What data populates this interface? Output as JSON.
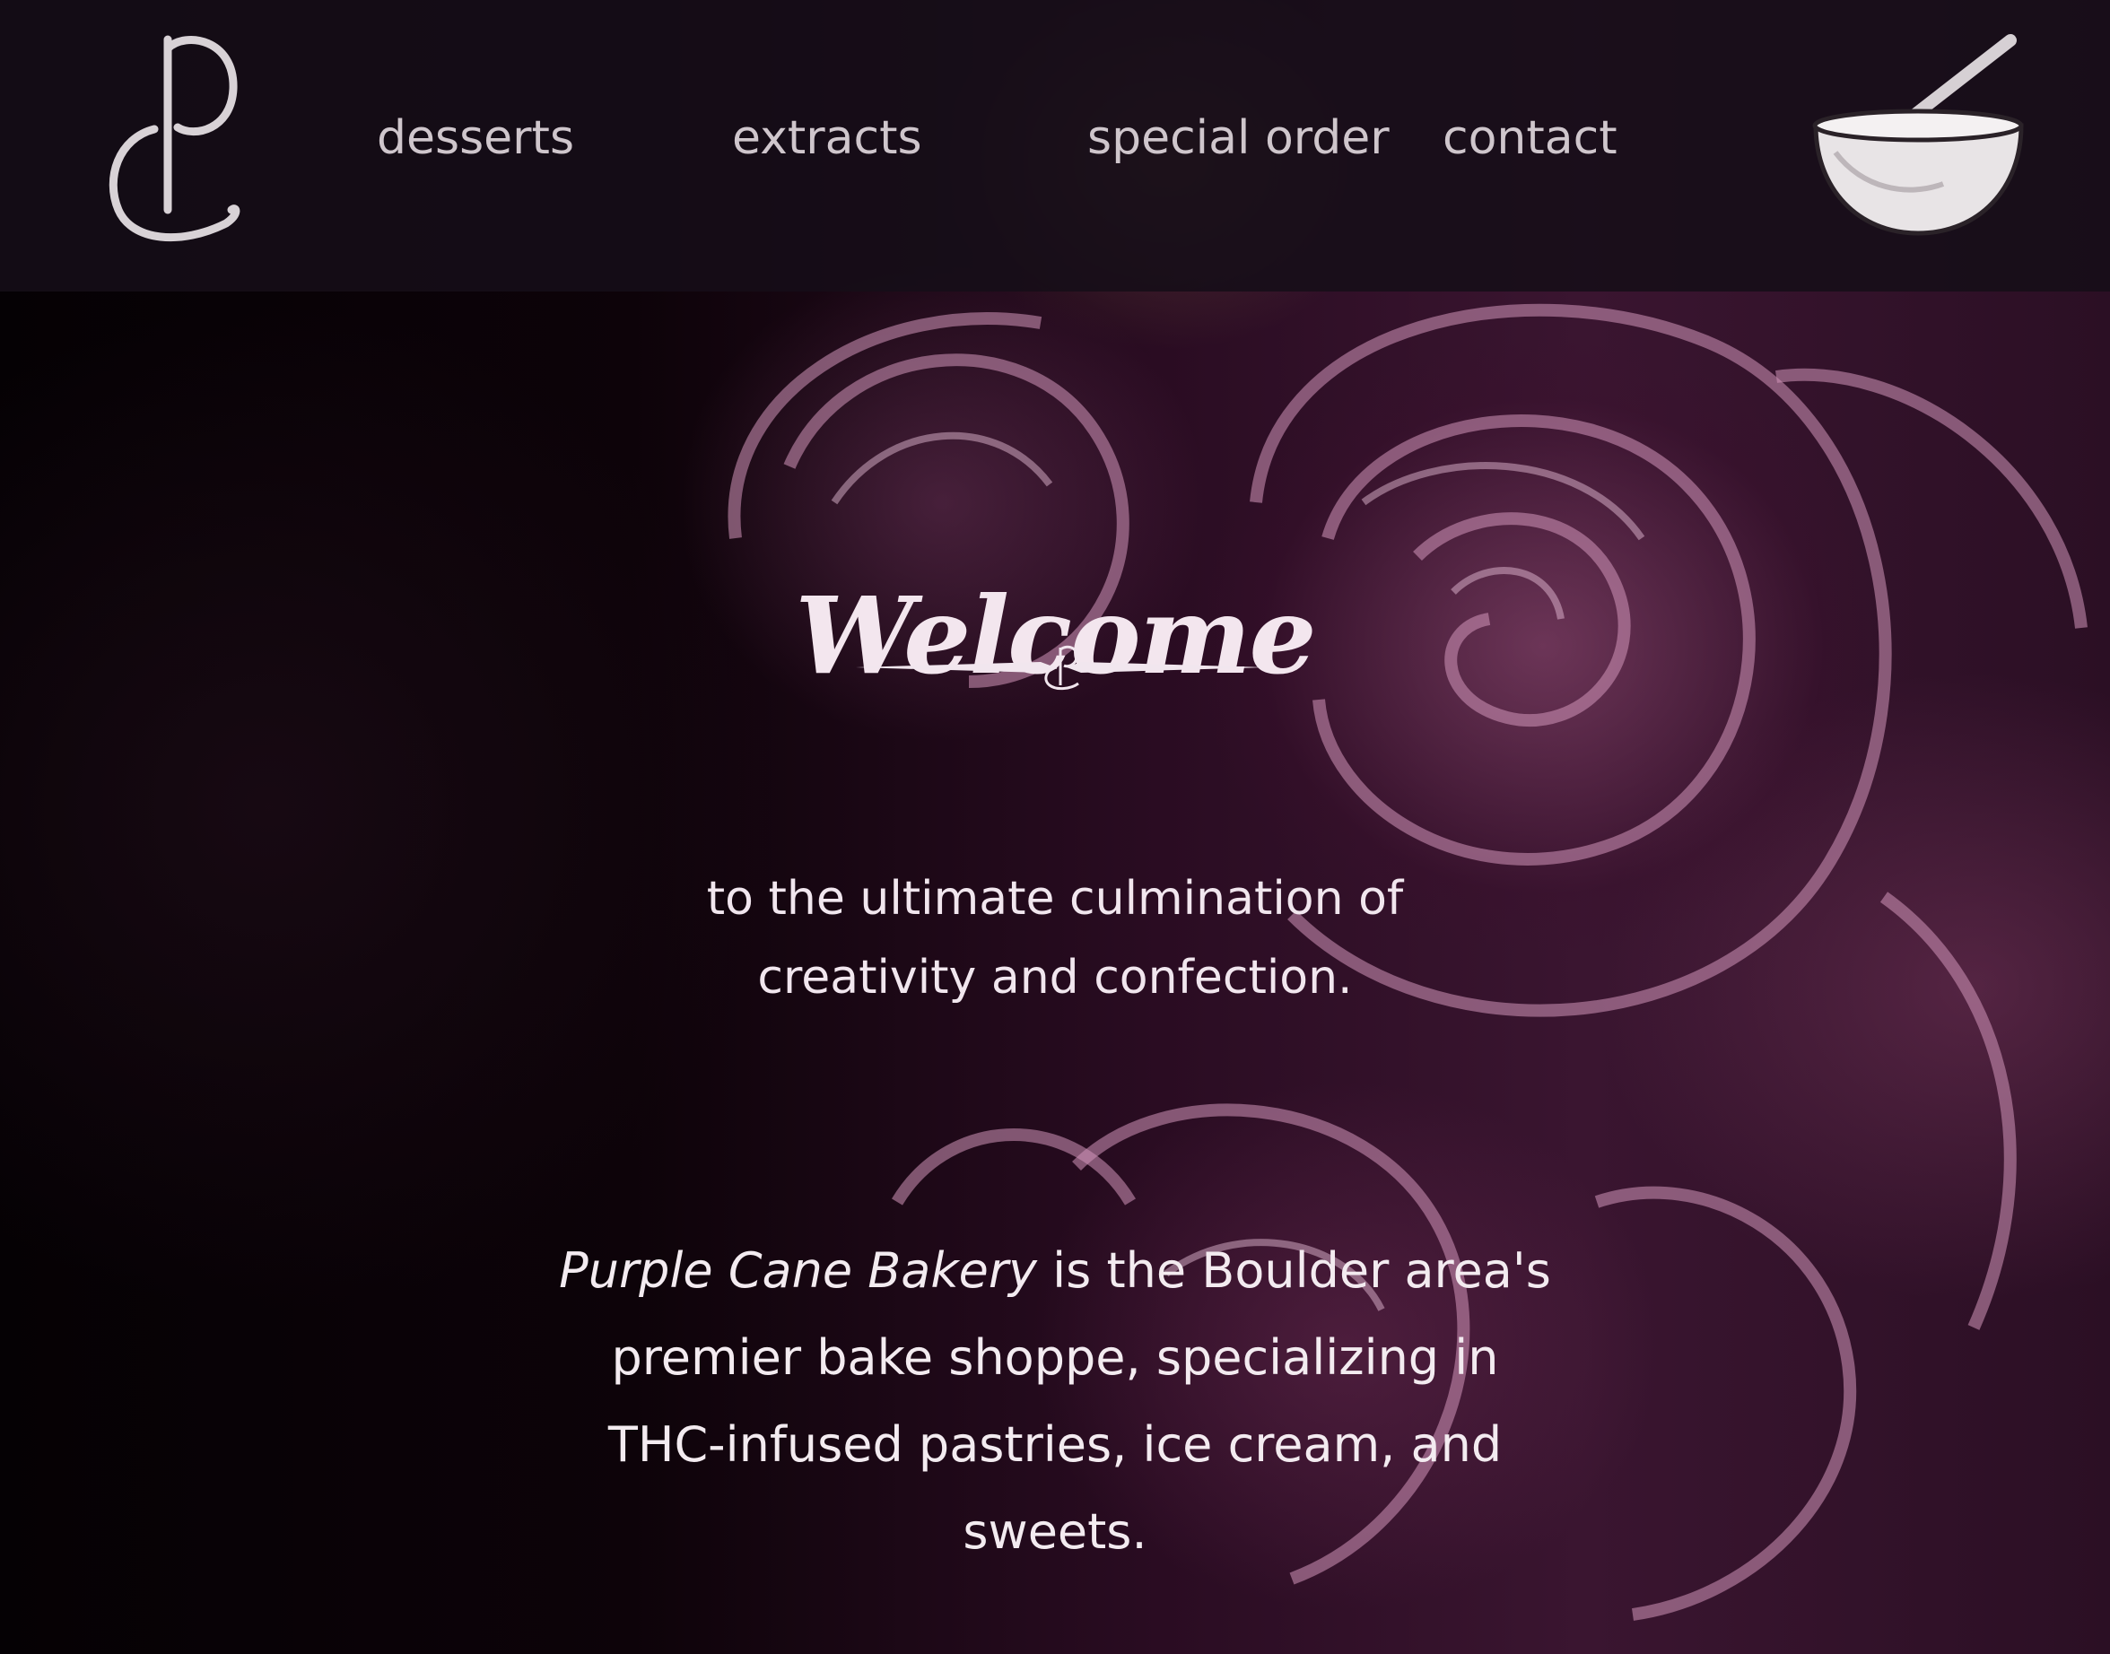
{
  "nav": {
    "desserts": "desserts",
    "extracts": "extracts",
    "special_order": "special order",
    "contact": "contact"
  },
  "icons": {
    "logo": "purple-cane-monogram-icon",
    "cart": "mixing-bowl-icon",
    "divider": "monogram-flourish-icon"
  },
  "hero": {
    "title": "Welcome",
    "tagline_line1": "to the ultimate culmination of",
    "tagline_line2": "creativity and confection.",
    "description_brand": "Purple Cane Bakery",
    "description_line1_rest": " is the Boulder area's",
    "description_line2": "premier bake shoppe, specializing in",
    "description_line3": "THC-infused pastries, ice cream, and",
    "description_line4": "sweets."
  },
  "colors": {
    "header_bg": "#160e18",
    "nav_text": "#cfc6cc",
    "hero_text": "#f3e6ee"
  }
}
